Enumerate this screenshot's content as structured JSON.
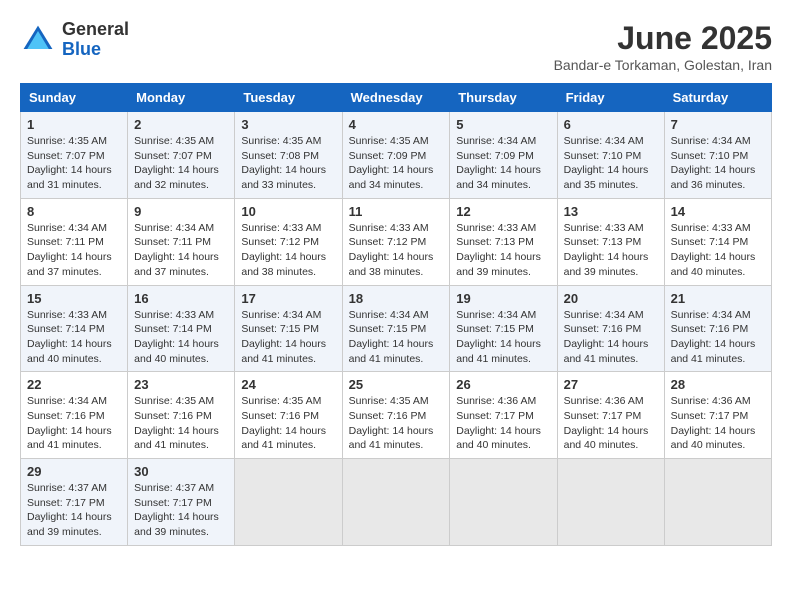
{
  "header": {
    "logo_general": "General",
    "logo_blue": "Blue",
    "month_title": "June 2025",
    "subtitle": "Bandar-e Torkaman, Golestan, Iran"
  },
  "days_of_week": [
    "Sunday",
    "Monday",
    "Tuesday",
    "Wednesday",
    "Thursday",
    "Friday",
    "Saturday"
  ],
  "weeks": [
    [
      {
        "day": "1",
        "info": "Sunrise: 4:35 AM\nSunset: 7:07 PM\nDaylight: 14 hours\nand 31 minutes."
      },
      {
        "day": "2",
        "info": "Sunrise: 4:35 AM\nSunset: 7:07 PM\nDaylight: 14 hours\nand 32 minutes."
      },
      {
        "day": "3",
        "info": "Sunrise: 4:35 AM\nSunset: 7:08 PM\nDaylight: 14 hours\nand 33 minutes."
      },
      {
        "day": "4",
        "info": "Sunrise: 4:35 AM\nSunset: 7:09 PM\nDaylight: 14 hours\nand 34 minutes."
      },
      {
        "day": "5",
        "info": "Sunrise: 4:34 AM\nSunset: 7:09 PM\nDaylight: 14 hours\nand 34 minutes."
      },
      {
        "day": "6",
        "info": "Sunrise: 4:34 AM\nSunset: 7:10 PM\nDaylight: 14 hours\nand 35 minutes."
      },
      {
        "day": "7",
        "info": "Sunrise: 4:34 AM\nSunset: 7:10 PM\nDaylight: 14 hours\nand 36 minutes."
      }
    ],
    [
      {
        "day": "8",
        "info": "Sunrise: 4:34 AM\nSunset: 7:11 PM\nDaylight: 14 hours\nand 37 minutes."
      },
      {
        "day": "9",
        "info": "Sunrise: 4:34 AM\nSunset: 7:11 PM\nDaylight: 14 hours\nand 37 minutes."
      },
      {
        "day": "10",
        "info": "Sunrise: 4:33 AM\nSunset: 7:12 PM\nDaylight: 14 hours\nand 38 minutes."
      },
      {
        "day": "11",
        "info": "Sunrise: 4:33 AM\nSunset: 7:12 PM\nDaylight: 14 hours\nand 38 minutes."
      },
      {
        "day": "12",
        "info": "Sunrise: 4:33 AM\nSunset: 7:13 PM\nDaylight: 14 hours\nand 39 minutes."
      },
      {
        "day": "13",
        "info": "Sunrise: 4:33 AM\nSunset: 7:13 PM\nDaylight: 14 hours\nand 39 minutes."
      },
      {
        "day": "14",
        "info": "Sunrise: 4:33 AM\nSunset: 7:14 PM\nDaylight: 14 hours\nand 40 minutes."
      }
    ],
    [
      {
        "day": "15",
        "info": "Sunrise: 4:33 AM\nSunset: 7:14 PM\nDaylight: 14 hours\nand 40 minutes."
      },
      {
        "day": "16",
        "info": "Sunrise: 4:33 AM\nSunset: 7:14 PM\nDaylight: 14 hours\nand 40 minutes."
      },
      {
        "day": "17",
        "info": "Sunrise: 4:34 AM\nSunset: 7:15 PM\nDaylight: 14 hours\nand 41 minutes."
      },
      {
        "day": "18",
        "info": "Sunrise: 4:34 AM\nSunset: 7:15 PM\nDaylight: 14 hours\nand 41 minutes."
      },
      {
        "day": "19",
        "info": "Sunrise: 4:34 AM\nSunset: 7:15 PM\nDaylight: 14 hours\nand 41 minutes."
      },
      {
        "day": "20",
        "info": "Sunrise: 4:34 AM\nSunset: 7:16 PM\nDaylight: 14 hours\nand 41 minutes."
      },
      {
        "day": "21",
        "info": "Sunrise: 4:34 AM\nSunset: 7:16 PM\nDaylight: 14 hours\nand 41 minutes."
      }
    ],
    [
      {
        "day": "22",
        "info": "Sunrise: 4:34 AM\nSunset: 7:16 PM\nDaylight: 14 hours\nand 41 minutes."
      },
      {
        "day": "23",
        "info": "Sunrise: 4:35 AM\nSunset: 7:16 PM\nDaylight: 14 hours\nand 41 minutes."
      },
      {
        "day": "24",
        "info": "Sunrise: 4:35 AM\nSunset: 7:16 PM\nDaylight: 14 hours\nand 41 minutes."
      },
      {
        "day": "25",
        "info": "Sunrise: 4:35 AM\nSunset: 7:16 PM\nDaylight: 14 hours\nand 41 minutes."
      },
      {
        "day": "26",
        "info": "Sunrise: 4:36 AM\nSunset: 7:17 PM\nDaylight: 14 hours\nand 40 minutes."
      },
      {
        "day": "27",
        "info": "Sunrise: 4:36 AM\nSunset: 7:17 PM\nDaylight: 14 hours\nand 40 minutes."
      },
      {
        "day": "28",
        "info": "Sunrise: 4:36 AM\nSunset: 7:17 PM\nDaylight: 14 hours\nand 40 minutes."
      }
    ],
    [
      {
        "day": "29",
        "info": "Sunrise: 4:37 AM\nSunset: 7:17 PM\nDaylight: 14 hours\nand 39 minutes."
      },
      {
        "day": "30",
        "info": "Sunrise: 4:37 AM\nSunset: 7:17 PM\nDaylight: 14 hours\nand 39 minutes."
      },
      {
        "day": "",
        "info": ""
      },
      {
        "day": "",
        "info": ""
      },
      {
        "day": "",
        "info": ""
      },
      {
        "day": "",
        "info": ""
      },
      {
        "day": "",
        "info": ""
      }
    ]
  ]
}
